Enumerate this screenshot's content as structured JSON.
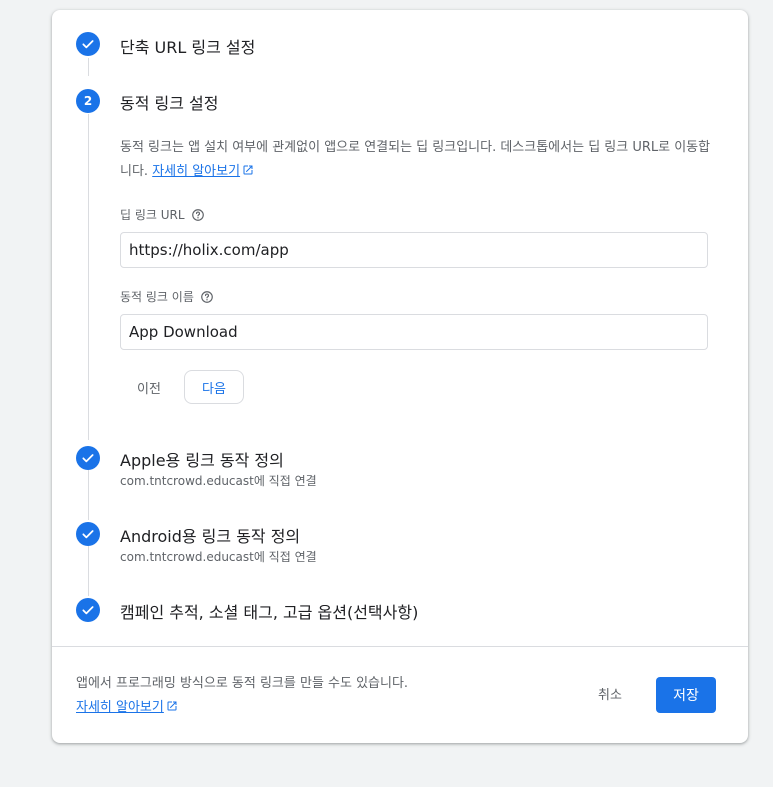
{
  "steps": [
    {
      "title": "단축 URL 링크 설정",
      "status": "complete"
    },
    {
      "number": "2",
      "title": "동적 링크 설정",
      "status": "active"
    },
    {
      "title": "Apple용 링크 동작 정의",
      "subtitle": "com.tntcrowd.educast에 직접 연결",
      "status": "complete"
    },
    {
      "title": "Android용 링크 동작 정의",
      "subtitle": "com.tntcrowd.educast에 직접 연결",
      "status": "complete"
    },
    {
      "title": "캠페인 추적, 소셜 태그, 고급 옵션(선택사항)",
      "status": "complete"
    }
  ],
  "active_step": {
    "description": "동적 링크는 앱 설치 여부에 관계없이 앱으로 연결되는 딥 링크입니다. 데스크톱에서는 딥 링크 URL로 이동합니다.",
    "learn_more": "자세히 알아보기",
    "deep_link_label": "딥 링크 URL",
    "deep_link_value": "https://holix.com/app",
    "link_name_label": "동적 링크 이름",
    "link_name_value": "App Download",
    "back_label": "이전",
    "next_label": "다음"
  },
  "footer": {
    "text": "앱에서 프로그래밍 방식으로 동적 링크를 만들 수도 있습니다.",
    "learn_more": "자세히 알아보기",
    "cancel_label": "취소",
    "save_label": "저장"
  },
  "colors": {
    "accent": "#1a73e8",
    "divider": "#dadce0",
    "secondary_text": "#5f6368"
  },
  "icons": {
    "complete": "check-icon",
    "external": "open-in-new-icon",
    "help": "help-circle-icon"
  }
}
